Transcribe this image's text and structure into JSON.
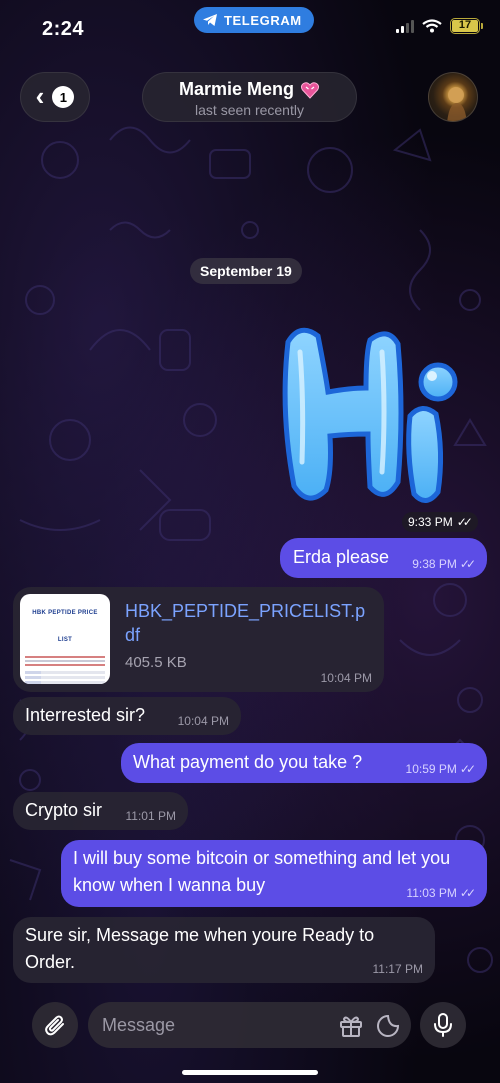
{
  "status_bar": {
    "time": "2:24",
    "app_pill": "TELEGRAM",
    "battery": "17"
  },
  "header": {
    "back_count": "1",
    "contact_name": "Marmie Meng",
    "contact_status": "last seen recently"
  },
  "date_divider": "September 19",
  "sticker": {
    "text": "Hi",
    "time": "9:33 PM"
  },
  "messages": [
    {
      "direction": "out",
      "text": "Erda please",
      "time": "9:38 PM",
      "read": true
    },
    {
      "direction": "in",
      "type": "file",
      "file_name": "HBK_PEPTIDE_PRICELIST.pdf",
      "file_size": "405.5 KB",
      "thumb_title": "HBK PEPTIDE PRICE LIST",
      "time": "10:04 PM"
    },
    {
      "direction": "in",
      "text": "Interrested sir?",
      "time": "10:04 PM"
    },
    {
      "direction": "out",
      "text": "What payment do you take ?",
      "time": "10:59 PM",
      "read": true
    },
    {
      "direction": "in",
      "text": "Crypto sir",
      "time": "11:01 PM"
    },
    {
      "direction": "out",
      "text": "I will buy some bitcoin or something and let you know when I wanna buy",
      "time": "11:03 PM",
      "read": true
    },
    {
      "direction": "in",
      "text": "Sure sir, Message me when youre Ready to Order.",
      "time": "11:17 PM"
    }
  ],
  "composer": {
    "placeholder": "Message"
  },
  "colors": {
    "outgoing_bubble": "#5c4de6",
    "incoming_bubble": "#28243a",
    "link": "#7ba3ff",
    "telegram_blue": "#2f7de0"
  }
}
